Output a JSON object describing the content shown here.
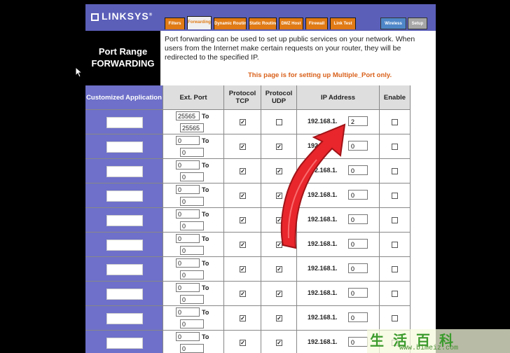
{
  "header": {
    "logo": "LINKSYS",
    "logo_reg": "®",
    "tabs": [
      "Filters",
      "Forwarding",
      "Dynamic Routing",
      "Static Routing",
      "DMZ Host",
      "Firewall",
      "Link Test"
    ],
    "active_tab": "Forwarding",
    "right_tabs": [
      "Wireless",
      "Setup"
    ]
  },
  "page": {
    "title_line1": "Port Range",
    "title_line2": "FORWARDING",
    "description": "Port forwarding can be used to set up public services on your network. When users from the Internet make certain requests on your router, they will be redirected to the specified IP.",
    "note": "This page is for setting up Multiple_Port only."
  },
  "table": {
    "headers": {
      "application": "Customized Application",
      "ext_port": "Ext. Port",
      "tcp": "Protocol TCP",
      "udp": "Protocol UDP",
      "ip": "IP Address",
      "enable": "Enable"
    },
    "to_label": "To",
    "ip_prefix": "192.168.1.",
    "rows": [
      {
        "app": "",
        "start": "25565",
        "end": "25565",
        "tcp": true,
        "udp": false,
        "ip": "2",
        "enable": false
      },
      {
        "app": "",
        "start": "0",
        "end": "0",
        "tcp": true,
        "udp": true,
        "ip": "0",
        "enable": false
      },
      {
        "app": "",
        "start": "0",
        "end": "0",
        "tcp": true,
        "udp": true,
        "ip": "0",
        "enable": false
      },
      {
        "app": "",
        "start": "0",
        "end": "0",
        "tcp": true,
        "udp": true,
        "ip": "0",
        "enable": false
      },
      {
        "app": "",
        "start": "0",
        "end": "0",
        "tcp": true,
        "udp": true,
        "ip": "0",
        "enable": false
      },
      {
        "app": "",
        "start": "0",
        "end": "0",
        "tcp": true,
        "udp": true,
        "ip": "0",
        "enable": false
      },
      {
        "app": "",
        "start": "0",
        "end": "0",
        "tcp": true,
        "udp": true,
        "ip": "0",
        "enable": false
      },
      {
        "app": "",
        "start": "0",
        "end": "0",
        "tcp": true,
        "udp": true,
        "ip": "0",
        "enable": false
      },
      {
        "app": "",
        "start": "0",
        "end": "0",
        "tcp": true,
        "udp": true,
        "ip": "0",
        "enable": false
      },
      {
        "app": "",
        "start": "0",
        "end": "0",
        "tcp": true,
        "udp": true,
        "ip": "0",
        "enable": false
      }
    ]
  },
  "watermark": {
    "chars": "生活百科",
    "url": "www.bimeiz.com"
  },
  "colors": {
    "brand": "#5b5fb8",
    "tab_orange": "#e07a14",
    "arrow_red": "#e8262c"
  }
}
